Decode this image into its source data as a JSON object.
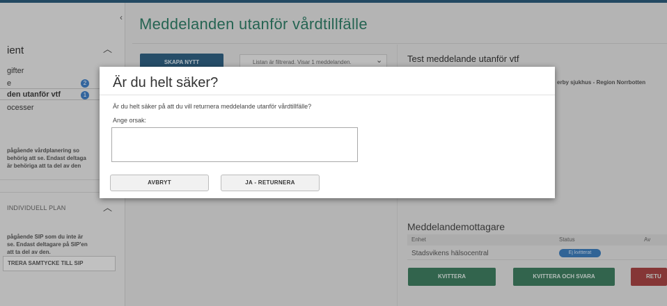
{
  "sidebar": {
    "collapse_icon": "‹",
    "section_title": "ient",
    "section_caret": "︿",
    "items": [
      {
        "label": "gifter"
      },
      {
        "label": "e",
        "badge": "2"
      },
      {
        "label": "den utanför vtf",
        "badge": "1"
      },
      {
        "label": "ocesser"
      }
    ],
    "note_lines": [
      "pågående vårdplanering so",
      "behörig att se. Endast deltaga",
      "är behöriga att ta del av den"
    ],
    "sip_title": "INDIVIDUELL PLAN",
    "sip_caret": "︿",
    "sip_note_lines": [
      "pågående SIP som du inte är",
      "se. Endast deltagare på SIP'en",
      "att ta del av den."
    ],
    "sip_button": "TRERA SAMTYCKE TILL SIP"
  },
  "main": {
    "page_title": "Meddelanden utanför vårdtillfälle",
    "create_button": "SKAPA NYTT",
    "filter_text": "Listan är filtrerad. Visar 1 meddelanden.",
    "filter_chevron": "⌄",
    "detail_title": "Test meddelande utanför vtf",
    "detail_org": "erby sjukhus - Region Norrbotten",
    "recipients": {
      "title": "Meddelandemottagare",
      "headers": [
        "Enhet",
        "Status",
        "Av"
      ],
      "rows": [
        {
          "unit": "Stadsvikens hälsocentral",
          "status": "Ej kvitterat"
        }
      ]
    },
    "actions": {
      "kvittera": "KVITTERA",
      "kvittera_svara": "KVITTERA OCH SVARA",
      "returnera": "RETU"
    }
  },
  "modal": {
    "title": "Är du helt säker?",
    "question": "Är du helt säker på att du vill returnera meddelande utanför vårdtillfälle?",
    "reason_label": "Ange orsak:",
    "reason_value": "",
    "cancel_button": "AVBRYT",
    "confirm_button": "JA - RETURNERA"
  },
  "colors": {
    "accent_green": "#2e7a64",
    "primary_blue": "#2f5f7f",
    "badge_blue": "#3f7cc0",
    "danger_red": "#a34343"
  }
}
